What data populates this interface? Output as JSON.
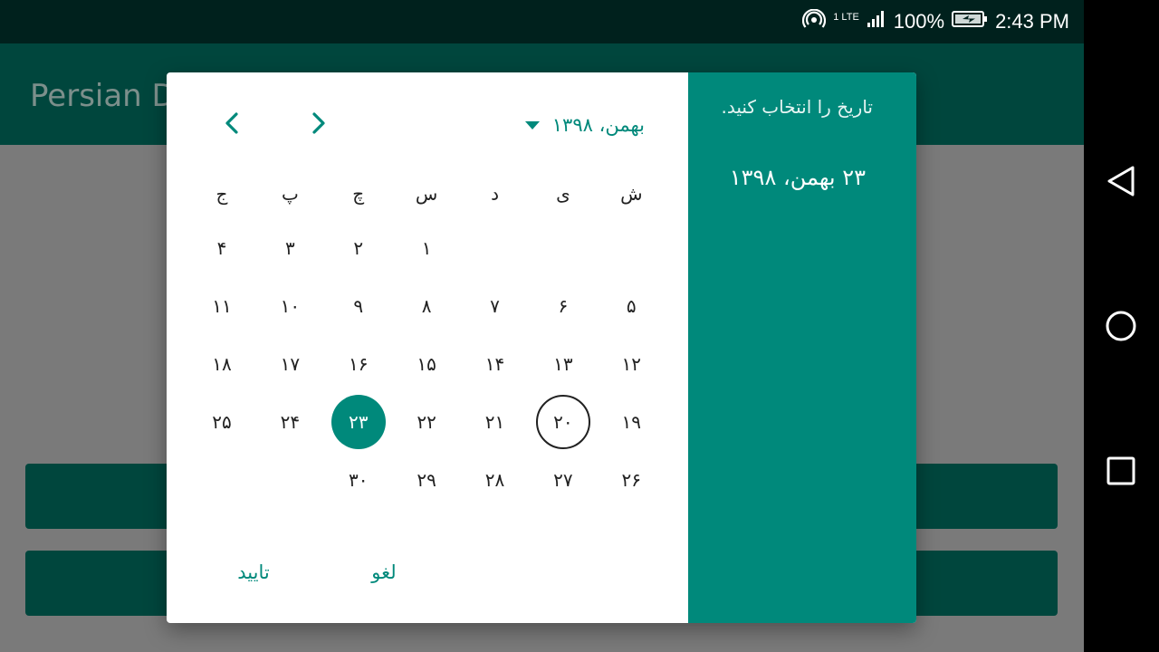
{
  "status": {
    "lte": "1 LTE",
    "battery": "100%",
    "time": "2:43 PM"
  },
  "app": {
    "title": "Persian D"
  },
  "dialog": {
    "header_prompt": "تاریخ را انتخاب کنید.",
    "header_date": "۲۳ بهمن، ۱۳۹۸",
    "month_label": "بهمن، ۱۳۹۸",
    "weekdays": [
      "ش",
      "ی",
      "د",
      "س",
      "چ",
      "پ",
      "ج"
    ],
    "weeks": [
      [
        "",
        "",
        "",
        "۱",
        "۲",
        "۳",
        "۴"
      ],
      [
        "۵",
        "۶",
        "۷",
        "۸",
        "۹",
        "۱۰",
        "۱۱"
      ],
      [
        "۱۲",
        "۱۳",
        "۱۴",
        "۱۵",
        "۱۶",
        "۱۷",
        "۱۸"
      ],
      [
        "۱۹",
        "۲۰",
        "۲۱",
        "۲۲",
        "۲۳",
        "۲۴",
        "۲۵"
      ],
      [
        "۲۶",
        "۲۷",
        "۲۸",
        "۲۹",
        "۳۰",
        "",
        ""
      ]
    ],
    "today_day": "۲۰",
    "selected_day": "۲۳",
    "cancel_label": "لغو",
    "confirm_label": "تایید"
  },
  "colors": {
    "accent": "#00897b",
    "primary_dark": "#00463d",
    "status_bar": "#00211d"
  },
  "icons": {
    "prev": "chevron-left-icon",
    "next": "chevron-right-icon",
    "dropdown": "triangle-down-icon",
    "back": "back-triangle-icon",
    "home": "home-circle-icon",
    "recents": "recents-square-icon"
  }
}
